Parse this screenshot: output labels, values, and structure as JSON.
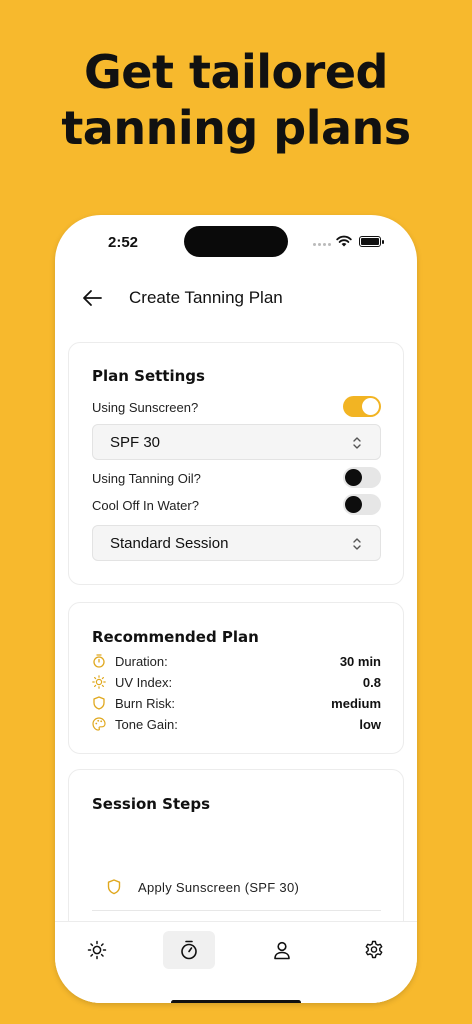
{
  "headline": {
    "line1": "Get tailored",
    "line2": "tanning plans"
  },
  "status_bar": {
    "time": "2:52"
  },
  "header": {
    "title": "Create Tanning Plan"
  },
  "plan_settings": {
    "title": "Plan Settings",
    "sunscreen_label": "Using Sunscreen?",
    "sunscreen_on": true,
    "spf_value": "SPF 30",
    "tanning_oil_label": "Using Tanning Oil?",
    "tanning_oil_on": false,
    "cool_off_label": "Cool Off In Water?",
    "cool_off_on": false,
    "session_value": "Standard Session"
  },
  "recommended_plan": {
    "title": "Recommended Plan",
    "rows": [
      {
        "icon": "timer-icon",
        "label": "Duration:",
        "value": "30 min"
      },
      {
        "icon": "sun-icon",
        "label": "UV Index:",
        "value": "0.8"
      },
      {
        "icon": "shield-icon",
        "label": "Burn Risk:",
        "value": "medium"
      },
      {
        "icon": "palette-icon",
        "label": "Tone Gain:",
        "value": "low"
      }
    ]
  },
  "session_steps": {
    "title": "Session Steps",
    "steps": [
      {
        "icon": "shield-icon",
        "text": "Apply Sunscreen (SPF 30)"
      }
    ]
  },
  "tabs": [
    {
      "icon": "sun-icon",
      "active": false
    },
    {
      "icon": "timer-icon",
      "active": true
    },
    {
      "icon": "person-icon",
      "active": false
    },
    {
      "icon": "gear-icon",
      "active": false
    }
  ],
  "colors": {
    "background": "#F7B92D",
    "accent": "#F2B423",
    "text": "#111111"
  }
}
